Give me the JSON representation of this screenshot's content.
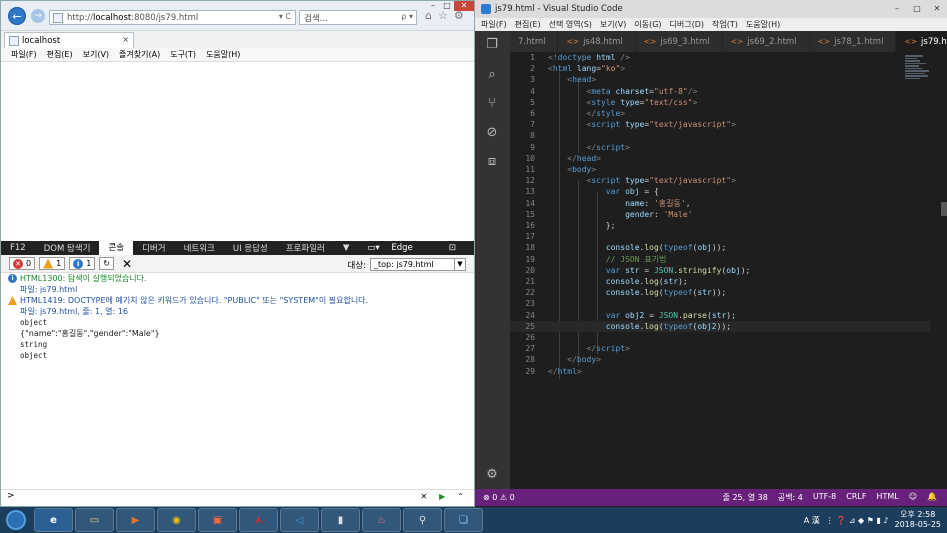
{
  "ie": {
    "url_prefix": "http://",
    "url_host": "localhost",
    "url_rest": ":8080/js79.html",
    "url_controls": "▾ C",
    "search_placeholder": "검색...",
    "search_controls": "ρ ▾",
    "tab_title": "localhost",
    "menu": [
      "파일(F)",
      "편집(E)",
      "보기(V)",
      "즐겨찾기(A)",
      "도구(T)",
      "도움말(H)"
    ]
  },
  "devtools": {
    "tabs": [
      "F12",
      "DOM 탐색기",
      "콘솔",
      "디버거",
      "네트워크",
      "UI 응답성",
      "프로파일러",
      "메모리",
      "Edge"
    ],
    "active_tab": "콘솔",
    "errors": "0",
    "warnings": "1",
    "infos": "1",
    "target_label": "대상:",
    "target_value": "_top: js79.html",
    "log": {
      "l1": "HTML1300: 탐색이 실행되었습니다.",
      "l2": "파일: js79.html",
      "l3": "HTML1419: DOCTYPE에 예기치 않은 키워드가 있습니다. \"PUBLIC\" 또는 \"SYSTEM\"이 필요합니다.",
      "l4": "파일: js79.html, 줄: 1, 열: 16",
      "l5": "object",
      "l6": "{\"name\":\"홍길동\",\"gender\":\"Male\"}",
      "l7": "string",
      "l8": "object"
    },
    "prompt": ">"
  },
  "vscode": {
    "window_title": "js79.html - Visual Studio Code",
    "menu": [
      "파일(F)",
      "편집(E)",
      "선택 영역(S)",
      "보기(V)",
      "이동(G)",
      "디버그(D)",
      "작업(T)",
      "도움말(H)"
    ],
    "tabs": [
      "7.html",
      "js48.html",
      "js69_3.html",
      "js69_2.html",
      "js78_1.html",
      "js79.html"
    ],
    "active_tab": "js79.html",
    "status_left": "⊗ 0 ⚠ 0",
    "status_right": [
      "줄 25, 열 38",
      "공백: 4",
      "UTF-8",
      "CRLF",
      "HTML",
      "☺",
      "🔔"
    ]
  },
  "taskbar": {
    "time": "오후 2:58",
    "date": "2018-05-25",
    "ime": "A 漢"
  },
  "accent": {
    "vs_status": "#68217a",
    "ie_blue": "#2f78c8"
  }
}
